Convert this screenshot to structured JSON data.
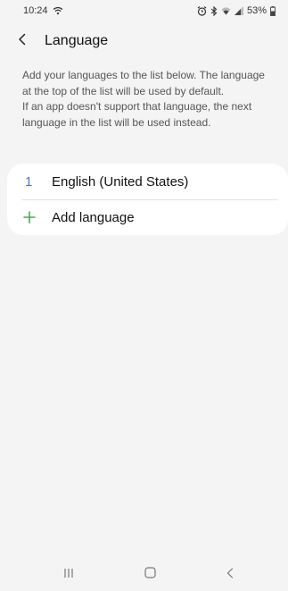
{
  "status_bar": {
    "time": "10:24",
    "battery": "53%"
  },
  "header": {
    "title": "Language"
  },
  "description": {
    "line1": "Add your languages to the list below. The language at the top of the list will be used by default.",
    "line2": "If an app doesn't support that language, the next language in the list will be used instead."
  },
  "languages": [
    {
      "index": "1",
      "name": "English (United States)"
    }
  ],
  "add_language": {
    "label": "Add language"
  },
  "colors": {
    "accent_blue": "#3a7bd5",
    "accent_green": "#3cb043",
    "background": "#f4f4f4",
    "card": "#ffffff"
  }
}
